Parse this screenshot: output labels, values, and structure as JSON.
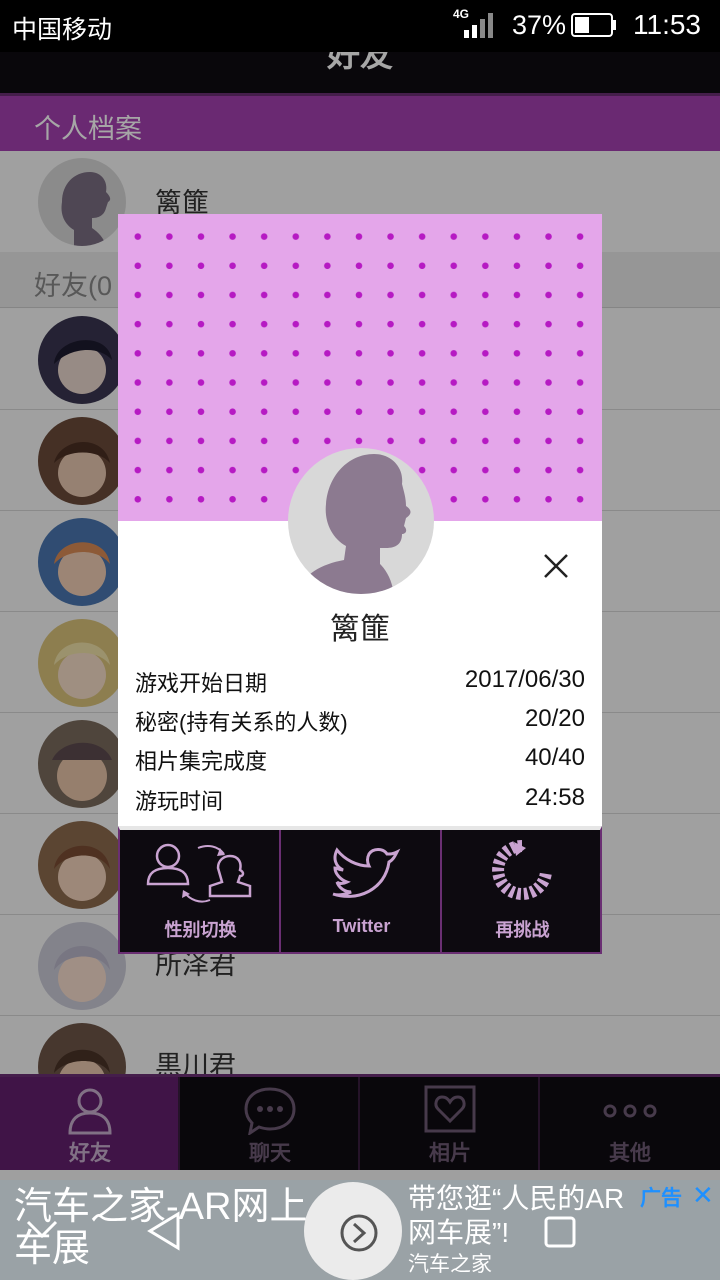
{
  "status_bar": {
    "carrier": "中国移动",
    "network": "4G",
    "battery_percent": "37%",
    "battery_level": 0.37,
    "time": "11:53"
  },
  "header": {
    "title": "好友"
  },
  "profile": {
    "section_label": "个人档案",
    "name": "篱篚"
  },
  "friends": {
    "header_label": "好友(0",
    "items": [
      {
        "name": ""
      },
      {
        "name": ""
      },
      {
        "name": ""
      },
      {
        "name": ""
      },
      {
        "name": ""
      },
      {
        "name": ""
      },
      {
        "name": "所泽君"
      },
      {
        "name": "黒川君"
      }
    ]
  },
  "dialog": {
    "name": "篱篚",
    "stats": [
      {
        "label": "游戏开始日期",
        "value": "2017/06/30"
      },
      {
        "label": "秘密(持有关系的人数)",
        "value": "20/20"
      },
      {
        "label": "相片集完成度",
        "value": "40/40"
      },
      {
        "label": "游玩时间",
        "value": "24:58"
      }
    ],
    "actions": [
      {
        "label": "性别切换",
        "icon": "gender-switch-icon"
      },
      {
        "label": "Twitter",
        "icon": "twitter-bird-icon"
      },
      {
        "label": "再挑战",
        "icon": "retry-icon"
      }
    ]
  },
  "tabs": [
    {
      "label": "好友",
      "icon": "person-icon",
      "active": true
    },
    {
      "label": "聊天",
      "icon": "chat-bubble-icon",
      "active": false
    },
    {
      "label": "相片",
      "icon": "heart-frame-icon",
      "active": false
    },
    {
      "label": "其他",
      "icon": "more-dots-icon",
      "active": false
    }
  ],
  "ad": {
    "left_text": "汽车之家-AR网上车展",
    "right_text": "带您逛“人民的AR网车展”!",
    "source": "汽车之家",
    "tag": "广告",
    "close": "✕"
  },
  "colors": {
    "accent_purple": "#a43fb0",
    "dot_pink": "#e4a6ea",
    "dot_magenta": "#b61ac3",
    "dark_bar": "#0e0b12",
    "ad_link_blue": "#1e90ff"
  }
}
